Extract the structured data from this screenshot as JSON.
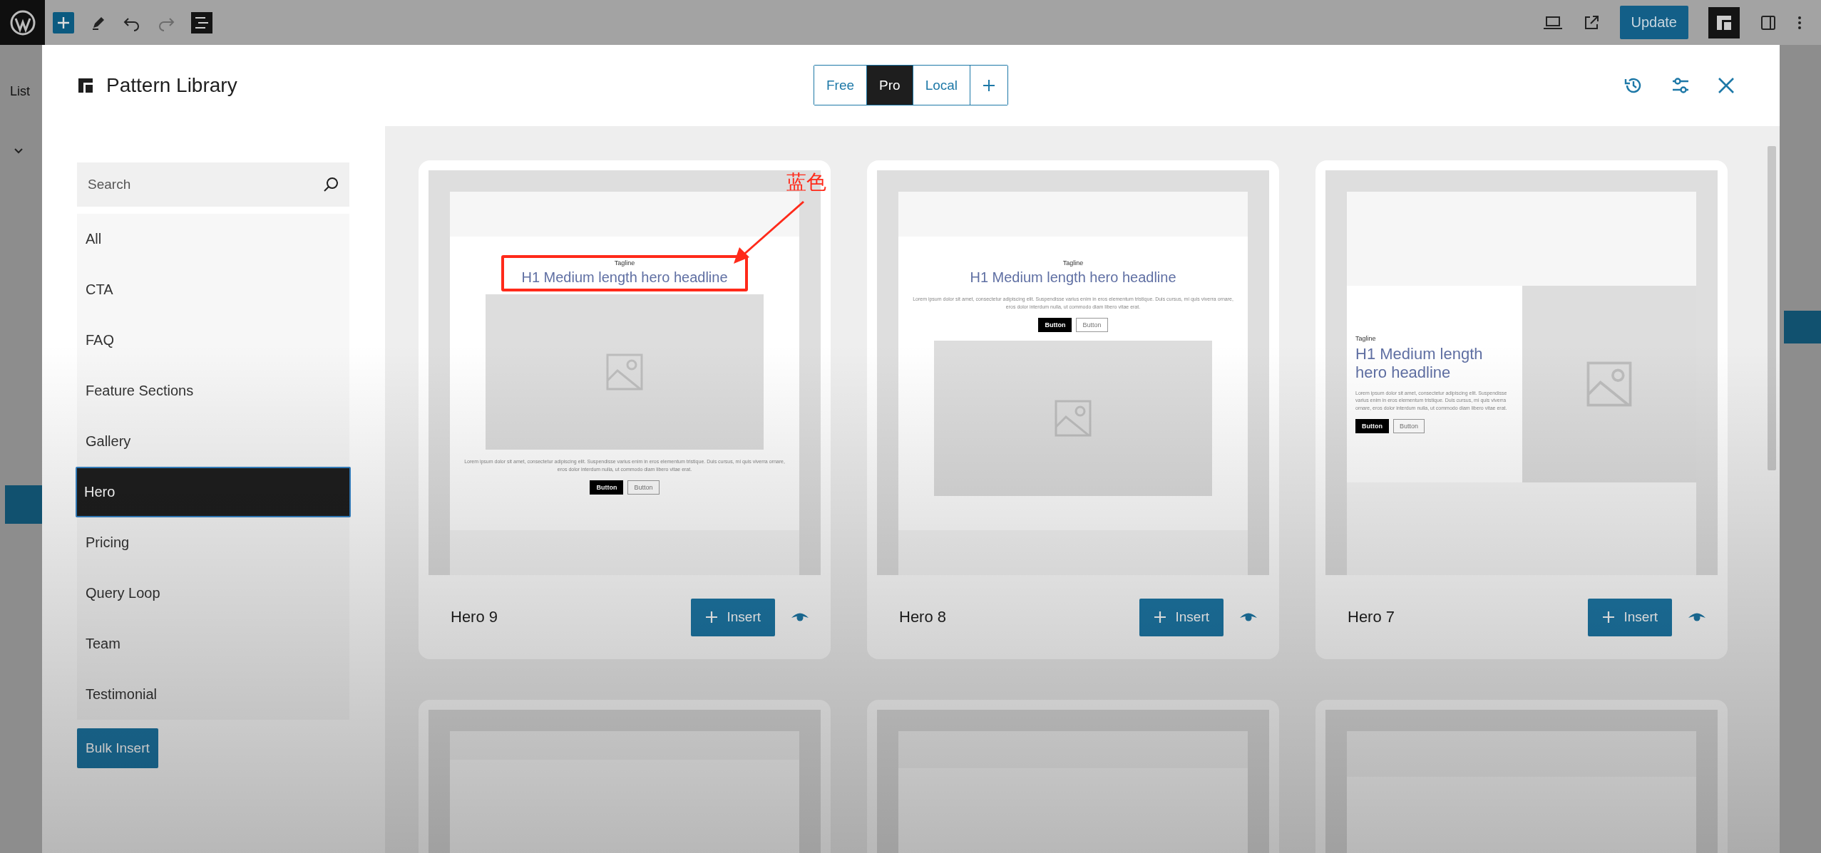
{
  "editor": {
    "sidebar_tab": "List",
    "update_button": "Update"
  },
  "modal": {
    "title": "Pattern Library",
    "source_tabs": [
      {
        "label": "Free",
        "selected": false
      },
      {
        "label": "Pro",
        "selected": true
      },
      {
        "label": "Local",
        "selected": false
      }
    ],
    "search": {
      "placeholder": "Search"
    },
    "categories": [
      {
        "label": "All",
        "selected": false
      },
      {
        "label": "CTA",
        "selected": false
      },
      {
        "label": "FAQ",
        "selected": false
      },
      {
        "label": "Feature Sections",
        "selected": false
      },
      {
        "label": "Gallery",
        "selected": false
      },
      {
        "label": "Hero",
        "selected": true
      },
      {
        "label": "Pricing",
        "selected": false
      },
      {
        "label": "Query Loop",
        "selected": false
      },
      {
        "label": "Team",
        "selected": false
      },
      {
        "label": "Testimonial",
        "selected": false
      }
    ],
    "bulk_insert": "Bulk Insert",
    "patterns": [
      {
        "name": "Hero 9",
        "insert": "Insert",
        "kind": "image-middle",
        "highlighted": true,
        "annotation": "蓝色",
        "preview": {
          "tagline": "Tagline",
          "headline": "H1 Medium length hero headline",
          "body": "Lorem ipsum dolor sit amet, consectetur adipiscing elit. Suspendisse varius enim in eros elementum tristique. Duis cursus, mi quis viverra ornare, eros dolor interdum nulla, ut commodo diam libero vitae erat.",
          "buttons": [
            "Button",
            "Button"
          ]
        }
      },
      {
        "name": "Hero 8",
        "insert": "Insert",
        "kind": "image-bottom",
        "highlighted": false,
        "preview": {
          "tagline": "Tagline",
          "headline": "H1 Medium length hero headline",
          "body": "Lorem ipsum dolor sit amet, consectetur adipiscing elit. Suspendisse varius enim in eros elementum tristique. Duis cursus, mi quis viverra ornare, eros dolor interdum nulla, ut commodo diam libero vitae erat.",
          "buttons": [
            "Button",
            "Button"
          ]
        }
      },
      {
        "name": "Hero 7",
        "insert": "Insert",
        "kind": "image-right",
        "highlighted": false,
        "preview": {
          "tagline": "Tagline",
          "headline": "H1 Medium length hero headline",
          "body": "Lorem ipsum dolor sit amet, consectetur adipiscing elit. Suspendisse varius enim in eros elementum tristique. Duis cursus, mi quis viverra ornare, eros dolor interdum nulla, ut commodo diam libero vitae erat.",
          "buttons": [
            "Button",
            "Button"
          ]
        }
      }
    ],
    "more_patterns": [
      {
        "kind": "short-top"
      },
      {
        "kind": "medium-top"
      },
      {
        "kind": "tall-top"
      }
    ]
  }
}
